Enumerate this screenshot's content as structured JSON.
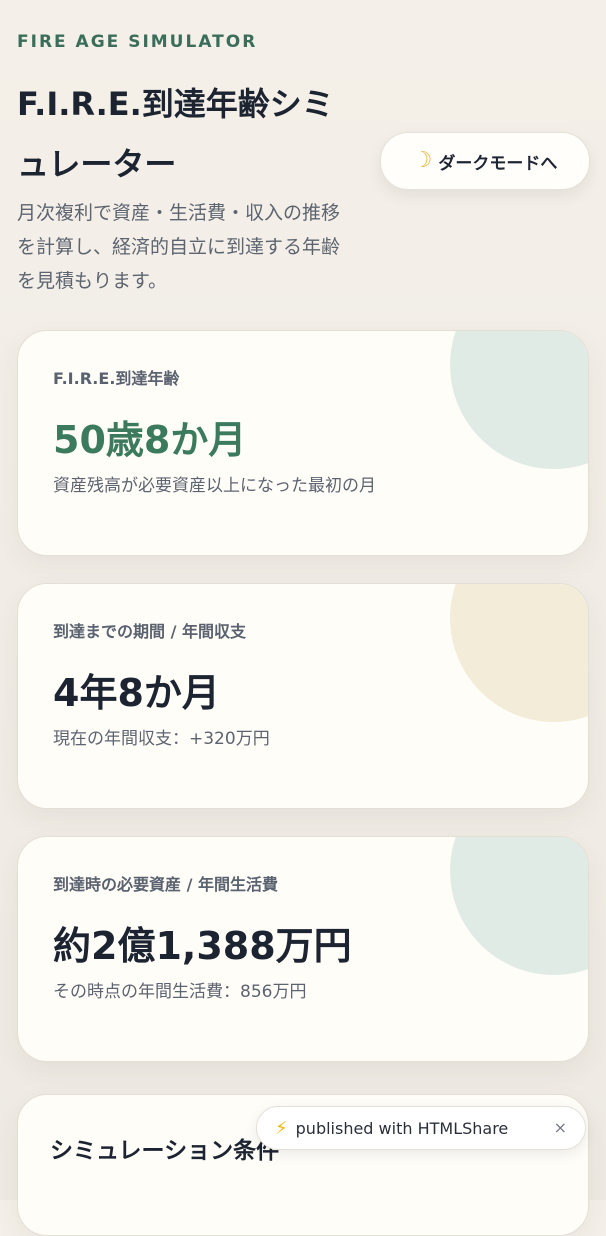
{
  "header": {
    "eyebrow": "FIRE AGE SIMULATOR",
    "title": "F.I.R.E.到達年齢シミュレーター",
    "description": "月次複利で資産・生活費・収入の推移を計算し、経済的自立に到達する年齢を見積もります。"
  },
  "theme_toggle": {
    "icon": "moon-icon",
    "label": "ダークモードへ"
  },
  "cards": [
    {
      "label": "F.I.R.E.到達年齢",
      "value": "50歳8か月",
      "note": "資産残高が必要資産以上になった最初の月",
      "accent_color": "#e1ebe6"
    },
    {
      "label": "到達までの期間 / 年間収支",
      "value": "4年8か月",
      "note": "現在の年間収支：+320万円",
      "accent_color": "#f3ecd9"
    },
    {
      "label": "到達時の必要資産 / 年間生活費",
      "value": "約2億1,388万円",
      "note": "その時点の年間生活費：856万円",
      "accent_color": "#e1ebe6"
    }
  ],
  "conditions": {
    "title": "シミュレーション条件"
  },
  "share_badge": {
    "icon": "lightning-icon",
    "text": "published with HTMLShare",
    "close": "×"
  },
  "colors": {
    "accent_green": "#3c7a5d",
    "background": "#f2eee7",
    "card_background": "#fffdf8"
  }
}
